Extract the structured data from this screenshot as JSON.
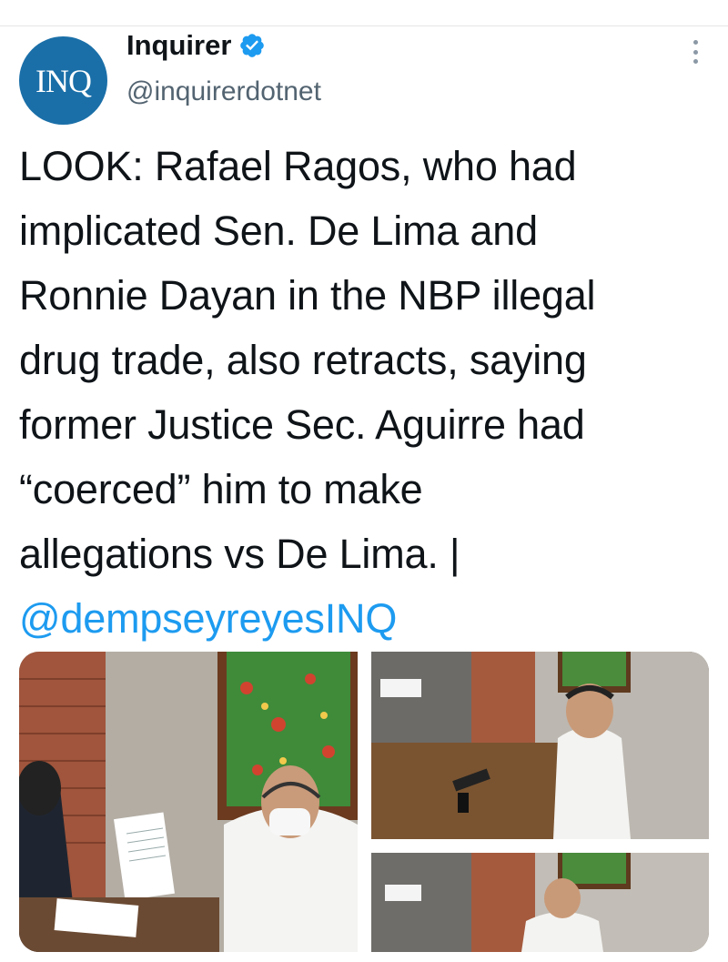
{
  "account": {
    "avatar_text": "INQ",
    "name": "Inquirer",
    "handle": "@inquirerdotnet",
    "verified": true
  },
  "tweet": {
    "lines": [
      "LOOK: Rafael Ragos, who had",
      "implicated Sen. De Lima and",
      "Ronnie Dayan in the NBP illegal",
      "drug trade, also retracts, saying",
      "former Justice Sec. Aguirre had",
      "“coerced” him to make",
      "allegations vs De Lima. |"
    ],
    "mention": "@dempseyreyesINQ"
  },
  "media": {
    "count": 3
  },
  "colors": {
    "link": "#1d9bf0",
    "avatar_bg": "#1a6fa8",
    "text": "#0f1419",
    "secondary": "#536471"
  }
}
